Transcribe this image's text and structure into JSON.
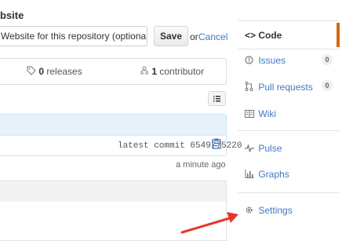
{
  "repo_details": {
    "website_label": "bsite",
    "website_input_value": "Website for this repository (optional)",
    "save_label": "Save",
    "or_text": "or",
    "cancel_label": "Cancel"
  },
  "stats": {
    "releases_count": "0",
    "releases_label": "releases",
    "contributors_count": "1",
    "contributors_label": "contributor"
  },
  "commit": {
    "latest_commit_text": "latest commit 6549775220",
    "time_ago": "a minute ago"
  },
  "sidebar": {
    "items": [
      {
        "label": "Code",
        "icon": "code-icon",
        "active": true
      },
      {
        "label": "Issues",
        "icon": "issue-icon",
        "count": "0"
      },
      {
        "label": "Pull requests",
        "icon": "pull-request-icon",
        "count": "0"
      },
      {
        "label": "Wiki",
        "icon": "book-icon"
      },
      {
        "label": "Pulse",
        "icon": "pulse-icon"
      },
      {
        "label": "Graphs",
        "icon": "graph-icon"
      },
      {
        "label": "Settings",
        "icon": "gear-icon"
      }
    ]
  },
  "colors": {
    "link": "#4078c0",
    "active_indicator": "#d26911",
    "annotation_arrow": "#e8352c",
    "commit_header_bg": "#e6f2f9"
  }
}
